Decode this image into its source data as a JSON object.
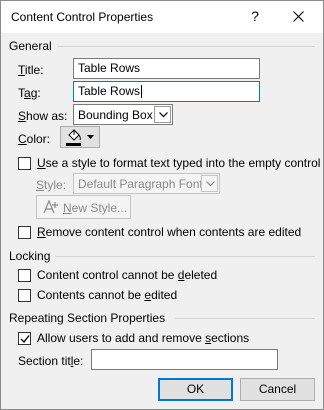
{
  "window": {
    "title": "Content Control Properties",
    "help_glyph": "?"
  },
  "general": {
    "section_label": "General",
    "title_label_ul": "T",
    "title_label_rest": "itle:",
    "title_value": "Table Rows",
    "tag_label_pre": "T",
    "tag_label_ul": "a",
    "tag_label_rest": "g:",
    "tag_value": "Table Rows",
    "showas_label_ul": "S",
    "showas_label_rest": "how as:",
    "showas_value": "Bounding Box",
    "color_label_ul": "C",
    "color_label_rest": "olor:",
    "color_value": "#000000",
    "use_style_label_ul": "U",
    "use_style_label_rest": "se a style to format text typed into the empty control",
    "use_style_checked": false,
    "style_label_ul": "S",
    "style_label_rest": "tyle:",
    "style_value": "Default Paragraph Font",
    "new_style_ul": "N",
    "new_style_rest": "ew Style...",
    "remove_label_ul": "R",
    "remove_label_rest": "emove content control when contents are edited",
    "remove_checked": false
  },
  "locking": {
    "section_label": "Locking",
    "cannot_delete_pre": "Content control cannot be ",
    "cannot_delete_ul": "d",
    "cannot_delete_rest": "eleted",
    "cannot_delete_checked": false,
    "cannot_edit_pre": "Contents cannot be ",
    "cannot_edit_ul": "e",
    "cannot_edit_rest": "dited",
    "cannot_edit_checked": false
  },
  "repeating": {
    "section_label": "Repeating Section Properties",
    "allow_pre": "Allow users to add and remove ",
    "allow_ul": "s",
    "allow_rest": "ections",
    "allow_checked": true,
    "section_title_pre": "Section tit",
    "section_title_ul": "l",
    "section_title_rest": "e:",
    "section_title_value": ""
  },
  "buttons": {
    "ok": "OK",
    "cancel": "Cancel"
  },
  "icons": {
    "close": "close-icon",
    "paint_bucket": "paint-bucket-icon",
    "dropdown": "chevron-down-icon",
    "checkmark": "checkmark-icon",
    "new_style": "new-style-icon"
  }
}
